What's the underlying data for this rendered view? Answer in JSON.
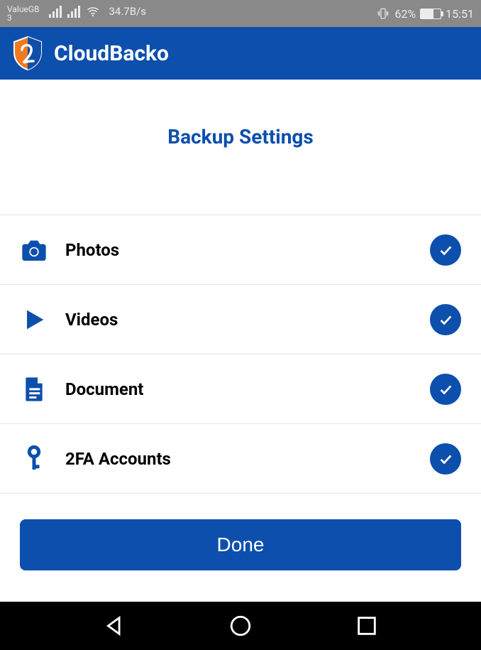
{
  "statusbar": {
    "carrier_line1": "ValueGB",
    "carrier_line2": "3",
    "speed": "34.7B/s",
    "battery_pct": "62%",
    "time": "15:51"
  },
  "header": {
    "app_name": "CloudBacko"
  },
  "page": {
    "title": "Backup Settings"
  },
  "rows": [
    {
      "icon": "camera-icon",
      "label": "Photos",
      "checked": true
    },
    {
      "icon": "play-icon",
      "label": "Videos",
      "checked": true
    },
    {
      "icon": "document-icon",
      "label": "Document",
      "checked": true
    },
    {
      "icon": "key-icon",
      "label": "2FA Accounts",
      "checked": true
    }
  ],
  "buttons": {
    "done": "Done"
  },
  "colors": {
    "primary": "#0c4fad",
    "statusbar_bg": "#898989"
  }
}
